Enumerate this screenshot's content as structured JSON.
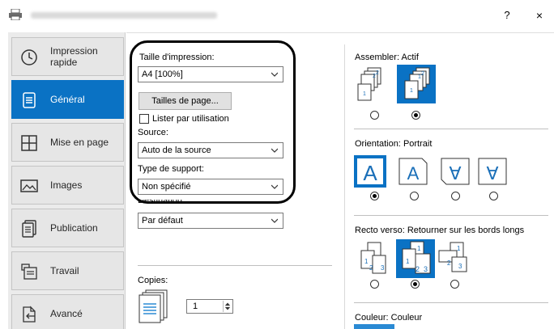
{
  "window": {
    "title": "",
    "help_label": "?",
    "close_label": "×"
  },
  "tabs": [
    {
      "label": "Impression rapide",
      "icon": "clock-icon",
      "active": false
    },
    {
      "label": "Général",
      "icon": "document-icon",
      "active": true
    },
    {
      "label": "Mise en page",
      "icon": "layout-icon",
      "active": false
    },
    {
      "label": "Images",
      "icon": "image-icon",
      "active": false
    },
    {
      "label": "Publication",
      "icon": "publication-icon",
      "active": false
    },
    {
      "label": "Travail",
      "icon": "job-icon",
      "active": false
    },
    {
      "label": "Avancé",
      "icon": "advanced-icon",
      "active": false
    }
  ],
  "general": {
    "print_size_label": "Taille d'impression:",
    "print_size_value": "A4  [100%]",
    "page_sizes_button": "Tailles de page...",
    "list_by_usage_label": "Lister par utilisation",
    "list_by_usage_checked": false,
    "source_label": "Source:",
    "source_value": "Auto de la source",
    "media_type_label": "Type de support:",
    "media_type_value": "Non spécifié",
    "destination_label": "Destination:",
    "destination_value": "Par défaut",
    "copies_label": "Copies:",
    "copies_value": "1"
  },
  "collate": {
    "label": "Assembler:",
    "value": "Actif",
    "selected_index": 1
  },
  "orientation": {
    "label": "Orientation:",
    "value": "Portrait",
    "options": [
      "A",
      "A",
      "∀",
      "∀"
    ],
    "selected_index": 0
  },
  "duplex": {
    "label": "Recto verso:",
    "value": "Retourner sur les bords longs",
    "selected_index": 1
  },
  "color": {
    "label": "Couleur:",
    "value": "Couleur"
  },
  "colors": {
    "accent": "#0a72c4",
    "tab_bg": "#e6e6e6",
    "highlight_border": "#000000"
  }
}
